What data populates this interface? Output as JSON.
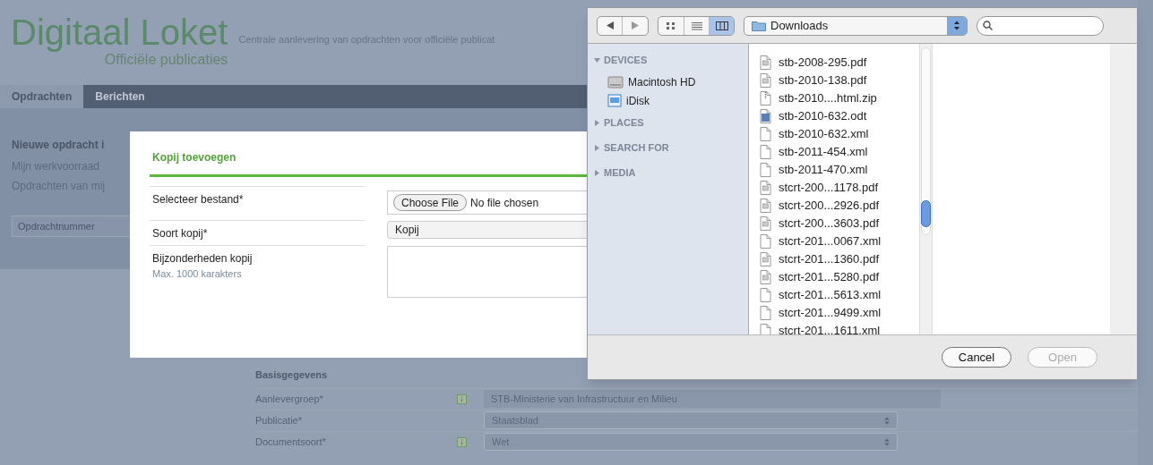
{
  "header": {
    "logo_title": "Digitaal Loket",
    "logo_subtitle": "Officiële publicaties",
    "tagline": "Centrale aanlevering van opdrachten voor officiële publicat"
  },
  "nav": {
    "tabs": [
      {
        "label": "Opdrachten",
        "selected": true
      },
      {
        "label": "Berichten",
        "selected": false
      }
    ]
  },
  "sidebar": {
    "links": [
      {
        "text": "Nieuwe opdracht i",
        "kind": "heading"
      },
      {
        "text": "Mijn werkvoorraad",
        "kind": "link"
      },
      {
        "text": "Opdrachten van mij",
        "kind": "link"
      }
    ],
    "search": {
      "placeholder": "Opdrachtnummer"
    }
  },
  "form": {
    "section_title": "Basisgegevens",
    "rows": [
      {
        "label": "Aanlevergroep*",
        "info": true,
        "kind": "text",
        "value": "STB-Ministerie van Infrastructuur en Milieu"
      },
      {
        "label": "Publicatie*",
        "info": false,
        "kind": "select",
        "value": "Staatsblad"
      },
      {
        "label": "Documentsoort*",
        "info": true,
        "kind": "select",
        "value": "Wet"
      }
    ]
  },
  "modal": {
    "title": "Kopij toevoegen",
    "rows": [
      {
        "label": "Selecteer bestand*",
        "kind": "file",
        "button": "Choose File",
        "value": "No file chosen"
      },
      {
        "label": "Soort kopij*",
        "kind": "select",
        "value": "Kopij"
      },
      {
        "label": "Bijzonderheden kopij",
        "hint": "Max. 1000 karakters",
        "kind": "textarea"
      }
    ]
  },
  "dialog": {
    "location": "Downloads",
    "views": [
      {
        "kind": "icons",
        "selected": false
      },
      {
        "kind": "list",
        "selected": false
      },
      {
        "kind": "columns",
        "selected": true
      }
    ],
    "sidebar": [
      {
        "label": "DEVICES",
        "expanded": true,
        "items": [
          {
            "label": "Macintosh HD",
            "kind": "disk"
          },
          {
            "label": "iDisk",
            "kind": "idisk"
          }
        ]
      },
      {
        "label": "PLACES",
        "expanded": false
      },
      {
        "label": "SEARCH FOR",
        "expanded": false
      },
      {
        "label": "MEDIA",
        "expanded": false
      }
    ],
    "files": [
      {
        "name": "stb-2008-295.pdf",
        "kind": "pdf"
      },
      {
        "name": "stb-2010-138.pdf",
        "kind": "pdf"
      },
      {
        "name": "stb-2010....html.zip",
        "kind": "zip"
      },
      {
        "name": "stb-2010-632.odt",
        "kind": "odt"
      },
      {
        "name": "stb-2010-632.xml",
        "kind": "xml"
      },
      {
        "name": "stb-2011-454.xml",
        "kind": "xml"
      },
      {
        "name": "stb-2011-470.xml",
        "kind": "xml"
      },
      {
        "name": "stcrt-200...1178.pdf",
        "kind": "pdf"
      },
      {
        "name": "stcrt-200...2926.pdf",
        "kind": "pdf"
      },
      {
        "name": "stcrt-200...3603.pdf",
        "kind": "pdf"
      },
      {
        "name": "stcrt-201...0067.xml",
        "kind": "xml"
      },
      {
        "name": "stcrt-201...1360.pdf",
        "kind": "pdf"
      },
      {
        "name": "stcrt-201...5280.pdf",
        "kind": "pdf"
      },
      {
        "name": "stcrt-201...5613.xml",
        "kind": "xml"
      },
      {
        "name": "stcrt-201...9499.xml",
        "kind": "xml"
      },
      {
        "name": "stcrt-201...1611.xml",
        "kind": "xml"
      }
    ],
    "buttons": [
      {
        "label": "Cancel",
        "disabled": false
      },
      {
        "label": "Open",
        "disabled": true
      }
    ]
  }
}
